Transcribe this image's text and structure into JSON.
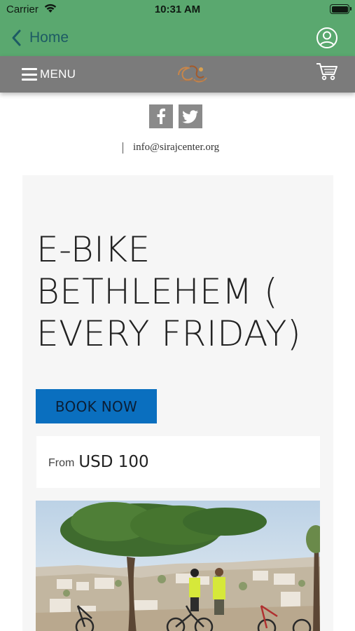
{
  "status_bar": {
    "carrier": "Carrier",
    "time": "10:31 AM"
  },
  "nav": {
    "back_label": "Home",
    "accent_color": "#5aa86f",
    "icons": [
      "chevron-left-icon",
      "user-circle-icon"
    ]
  },
  "header": {
    "menu_label": "MENU",
    "icons": [
      "hamburger-icon",
      "logo",
      "cart-icon"
    ],
    "background": "#7b7b7b"
  },
  "social": {
    "items": [
      "facebook-icon",
      "twitter-icon"
    ]
  },
  "contact": {
    "email": "info@sirajcenter.org"
  },
  "tour": {
    "title_lines": [
      "E-BIKE",
      "BETHLEHEM (",
      "EVERY FRIDAY)"
    ],
    "book_label": "BOOK NOW",
    "price_prefix": "From",
    "price": "USD 100",
    "button_color": "#0a6fbf"
  }
}
